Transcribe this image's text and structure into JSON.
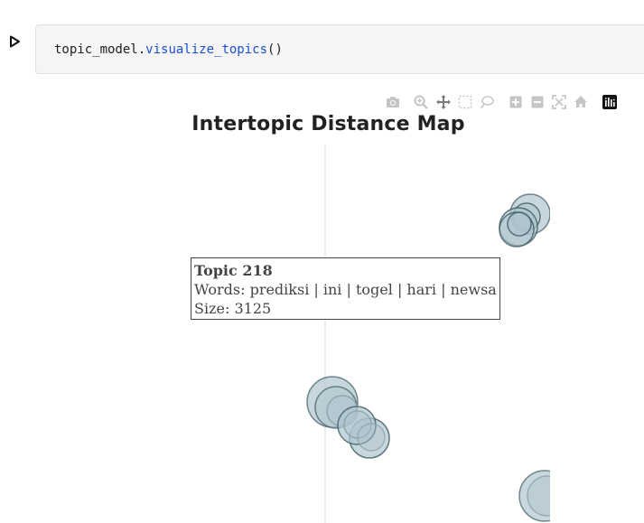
{
  "cell": {
    "code_object": "topic_model",
    "code_dot": ".",
    "code_method": "visualize_topics",
    "code_parens": "()"
  },
  "modebar": {
    "icons": [
      "camera-icon",
      "zoom-icon",
      "pan-icon",
      "box-select-icon",
      "lasso-select-icon",
      "zoom-in-icon",
      "zoom-out-icon",
      "autoscale-icon",
      "reset-axes-icon",
      "plotly-logo-icon"
    ]
  },
  "plot": {
    "title": "Intertopic Distance Map",
    "bubble_color": "#b0c4ce",
    "bubble_stroke": "#3f5c63",
    "axis_color": "#d9d9d9"
  },
  "tooltip": {
    "title": "Topic 218",
    "words": "Words: prediksi | ini | togel | hari | newsa",
    "size": "Size: 3125"
  },
  "chart_data": {
    "type": "scatter",
    "title": "Intertopic Distance Map",
    "xlabel": "",
    "ylabel": "",
    "grid": false,
    "legend": "none"
  }
}
